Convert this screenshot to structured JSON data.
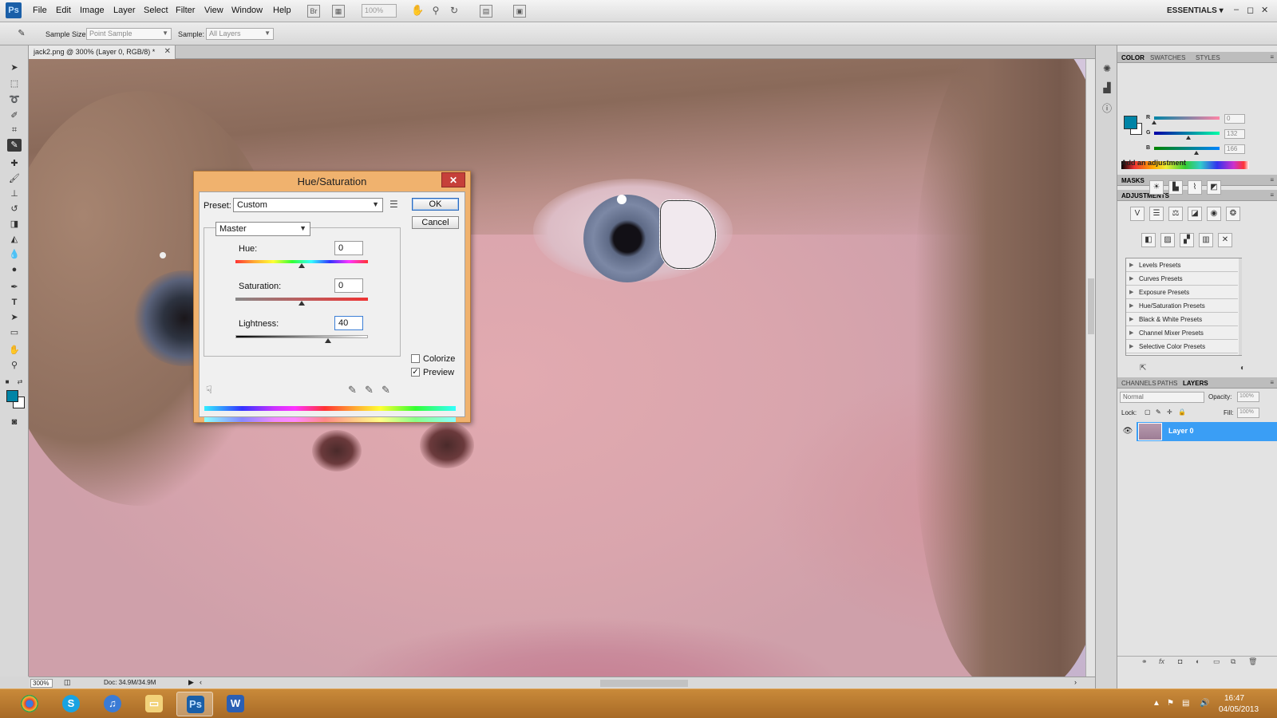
{
  "menubar": {
    "logo": "Ps",
    "items": [
      "File",
      "Edit",
      "Image",
      "Layer",
      "Select",
      "Filter",
      "View",
      "Window",
      "Help"
    ],
    "icons": [
      "bridge-icon",
      "mini-bridge-icon",
      "hand-icon",
      "zoom-icon",
      "rotate-view-icon",
      "arrange-documents-icon",
      "screen-mode-icon"
    ],
    "bridge_label": "Br",
    "zoom_value": "100%",
    "workspace": "ESSENTIALS ▾",
    "window_controls": [
      "–",
      "◻",
      "✕"
    ]
  },
  "options_bar": {
    "tool_icon": "eyedropper-icon",
    "sample_size_label": "Sample Size:",
    "sample_size_value": "Point Sample",
    "sample_label": "Sample:",
    "sample_value": "All Layers"
  },
  "tools": [
    "move-tool",
    "marquee-tool",
    "lasso-tool",
    "quick-select-tool",
    "crop-tool",
    "eyedropper-tool",
    "healing-brush-tool",
    "brush-tool",
    "clone-stamp-tool",
    "history-brush-tool",
    "eraser-tool",
    "gradient-tool",
    "blur-tool",
    "dodge-tool",
    "pen-tool",
    "type-tool",
    "path-select-tool",
    "shape-tool",
    "hand-tool",
    "zoom-tool"
  ],
  "document": {
    "tab_title": "jack2.png @ 300% (Layer 0, RGB/8) *",
    "zoom": "300%",
    "doc_size": "Doc: 34.9M/34.9M"
  },
  "color_panel": {
    "tabs": [
      "COLOR",
      "SWATCHES",
      "STYLES"
    ],
    "channels": [
      {
        "label": "R",
        "value": "0",
        "fraction": 0
      },
      {
        "label": "G",
        "value": "132",
        "fraction": 0.52
      },
      {
        "label": "B",
        "value": "166",
        "fraction": 0.65
      }
    ],
    "fg_color": "#0084a6"
  },
  "masks_panel": {
    "title": "MASKS"
  },
  "adjustments_panel": {
    "title": "ADJUSTMENTS",
    "subtitle": "Add an adjustment",
    "presets": [
      "Levels Presets",
      "Curves Presets",
      "Exposure Presets",
      "Hue/Saturation Presets",
      "Black & White Presets",
      "Channel Mixer Presets",
      "Selective Color Presets"
    ]
  },
  "layers_panel": {
    "tabs": [
      "CHANNELS",
      "PATHS",
      "LAYERS"
    ],
    "blend_mode": "Normal",
    "opacity_label": "Opacity:",
    "opacity_value": "100%",
    "lock_label": "Lock:",
    "fill_label": "Fill:",
    "fill_value": "100%",
    "layer_name": "Layer 0"
  },
  "dialog": {
    "title": "Hue/Saturation",
    "preset_label": "Preset:",
    "preset_value": "Custom",
    "channel_value": "Master",
    "hue_label": "Hue:",
    "hue_value": "0",
    "saturation_label": "Saturation:",
    "saturation_value": "0",
    "lightness_label": "Lightness:",
    "lightness_value": "40",
    "ok_label": "OK",
    "cancel_label": "Cancel",
    "colorize_label": "Colorize",
    "colorize_checked": false,
    "preview_label": "Preview",
    "preview_checked": true,
    "close_label": "✕"
  },
  "taskbar": {
    "apps": [
      "chrome-icon",
      "skype-icon",
      "itunes-icon",
      "file-explorer-icon",
      "photoshop-icon",
      "word-icon"
    ],
    "time": "16:47",
    "date": "04/05/2013"
  }
}
